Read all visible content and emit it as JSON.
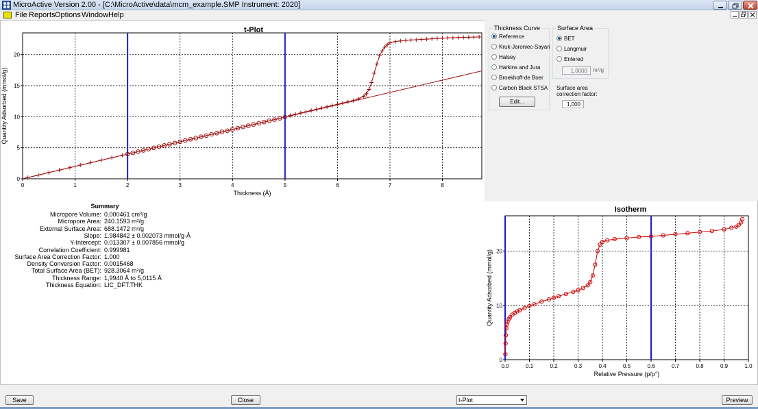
{
  "window": {
    "title": "MicroActive Version 2.00 - [C:\\MicroActive\\data\\mcm_example.SMP Instrument: 2020]"
  },
  "menu": {
    "items": [
      "File",
      "Reports",
      "Options",
      "Window",
      "Help"
    ]
  },
  "options": {
    "thickness_curve": {
      "label": "Thickness Curve",
      "choices": [
        "Reference",
        "Kruk-Jaroniec-Sayari",
        "Halsey",
        "Harkins and Jura",
        "Broekhoff-de Boer",
        "Carbon Black STSA"
      ],
      "selected": "Reference",
      "edit_label": "Edit..."
    },
    "surface_area": {
      "label": "Surface Area",
      "choices": [
        "BET",
        "Langmuir",
        "Entered"
      ],
      "selected": "BET",
      "entered_value": "1,0000",
      "entered_unit": "m²/g"
    },
    "correction": {
      "label": "Surface area correction factor:",
      "value": "1,000"
    }
  },
  "summary": {
    "title": "Summary",
    "rows": [
      {
        "label": "Micropore Volume:",
        "value": "0.000461 cm³/g"
      },
      {
        "label": "Micropore Area:",
        "value": "240.1593 m²/g"
      },
      {
        "label": "External Surface Area:",
        "value": "688.1472 m²/g"
      },
      {
        "label": "Slope:",
        "value": "1.984842 ± 0.002073 mmol/g·Å"
      },
      {
        "label": "Y-Intercept:",
        "value": "0.013307 ± 0.007856 mmol/g"
      },
      {
        "label": "Correlation Coefficient:",
        "value": "0.999981"
      },
      {
        "label": "Surface Area Correction Factor:",
        "value": "1.000"
      },
      {
        "label": "Density Conversion Factor:",
        "value": "0.0015468"
      },
      {
        "label": "Total Surface Area (BET):",
        "value": "928.3064 m²/g"
      },
      {
        "label": "Thickness Range:",
        "value": "1,9940 Å to 5,0115 Å"
      },
      {
        "label": "Thickness Equation:",
        "value": "LIC_DFT.THK"
      }
    ]
  },
  "bottom": {
    "save_label": "Save",
    "close_label": "Close",
    "view_selected": "t-Plot",
    "preview_label": "Preview"
  },
  "chart_data": [
    {
      "type": "scatter",
      "title": "t-Plot",
      "xlabel": "Thickness (Å)",
      "ylabel": "Quantity Adsorbed (mmol/g)",
      "xlim": [
        0,
        8.75
      ],
      "ylim": [
        0,
        23.5
      ],
      "xticks": [
        0,
        1,
        2,
        3,
        4,
        5,
        6,
        7,
        8
      ],
      "yticks": [
        0,
        5,
        10,
        15,
        20
      ],
      "grid": true,
      "colors": {
        "data": "#a01010",
        "fit": "#a01010",
        "range": "#1a1ad0"
      },
      "range_lines_x": [
        2.0,
        5.0
      ],
      "fit_line": {
        "slope": 1.984842,
        "intercept": 0.013307
      },
      "series": [
        {
          "marker": "cross",
          "x": [
            0.1,
            0.3,
            0.5,
            0.7,
            0.9,
            1.1,
            1.3,
            1.5,
            1.7,
            1.9
          ],
          "y": [
            0.2,
            0.6,
            1.0,
            1.4,
            1.8,
            2.2,
            2.6,
            3.0,
            3.4,
            3.8
          ]
        },
        {
          "marker": "circle",
          "x": [
            2.0,
            2.1,
            2.2,
            2.3,
            2.4,
            2.5,
            2.6,
            2.7,
            2.8,
            2.9,
            3.0,
            3.1,
            3.2,
            3.3,
            3.4,
            3.5,
            3.6,
            3.7,
            3.8,
            3.9,
            4.0,
            4.1,
            4.2,
            4.3,
            4.4,
            4.5,
            4.6,
            4.7,
            4.8,
            4.9,
            5.0
          ],
          "y": [
            3.98,
            4.18,
            4.38,
            4.58,
            4.78,
            4.98,
            5.17,
            5.37,
            5.57,
            5.77,
            5.97,
            6.17,
            6.37,
            6.56,
            6.76,
            6.96,
            7.16,
            7.36,
            7.56,
            7.75,
            7.95,
            8.15,
            8.35,
            8.55,
            8.75,
            8.94,
            9.14,
            9.34,
            9.54,
            9.74,
            9.94
          ]
        },
        {
          "marker": "cross",
          "x": [
            5.1,
            5.2,
            5.3,
            5.4,
            5.5,
            5.6,
            5.7,
            5.8,
            5.9,
            6.0,
            6.1,
            6.2,
            6.3,
            6.4,
            6.5,
            6.55,
            6.6,
            6.65,
            6.7,
            6.75,
            6.8,
            6.85,
            6.9,
            6.95,
            7.0,
            7.1,
            7.2,
            7.3,
            7.4,
            7.5,
            7.6,
            7.7,
            7.8,
            7.9,
            8.0,
            8.1,
            8.2,
            8.3,
            8.4,
            8.5,
            8.6,
            8.7
          ],
          "y": [
            10.2,
            10.4,
            10.6,
            10.8,
            11.0,
            11.2,
            11.4,
            11.6,
            11.8,
            12.0,
            12.2,
            12.4,
            12.6,
            12.9,
            13.3,
            13.7,
            14.4,
            15.5,
            17.0,
            18.5,
            19.8,
            20.6,
            21.2,
            21.6,
            21.9,
            22.1,
            22.2,
            22.3,
            22.35,
            22.4,
            22.45,
            22.5,
            22.55,
            22.6,
            22.65,
            22.7,
            22.72,
            22.75,
            22.78,
            22.8,
            22.82,
            22.85
          ]
        }
      ]
    },
    {
      "type": "scatter",
      "title": "Isotherm",
      "xlabel": "Relative Pressure (p/p°)",
      "ylabel": "Quantity Adsorbed (mmol/g)",
      "xlim": [
        0,
        1.0
      ],
      "ylim": [
        0,
        26.5
      ],
      "xticks": [
        0.0,
        0.1,
        0.2,
        0.3,
        0.4,
        0.5,
        0.6,
        0.7,
        0.8,
        0.9,
        1.0
      ],
      "yticks": [
        0,
        10,
        20
      ],
      "grid": true,
      "colors": {
        "data": "#d00000",
        "range": "#1a1ad0"
      },
      "range_lines_x": [
        0.0,
        0.6
      ],
      "series": [
        {
          "marker": "circle",
          "x": [
            0.001,
            0.002,
            0.003,
            0.005,
            0.008,
            0.01,
            0.015,
            0.02,
            0.03,
            0.04,
            0.05,
            0.06,
            0.08,
            0.1,
            0.12,
            0.15,
            0.18,
            0.2,
            0.22,
            0.25,
            0.28,
            0.3,
            0.32,
            0.34,
            0.35,
            0.36,
            0.37,
            0.38,
            0.39,
            0.4,
            0.42,
            0.45,
            0.5,
            0.55,
            0.6,
            0.65,
            0.7,
            0.75,
            0.8,
            0.85,
            0.9,
            0.93,
            0.95,
            0.96,
            0.97,
            0.975
          ],
          "y": [
            1.0,
            3.0,
            4.5,
            5.8,
            6.5,
            7.0,
            7.5,
            7.8,
            8.3,
            8.6,
            8.9,
            9.1,
            9.5,
            9.9,
            10.2,
            10.7,
            11.1,
            11.4,
            11.7,
            12.1,
            12.5,
            12.8,
            13.2,
            13.7,
            14.3,
            15.5,
            17.5,
            20.0,
            21.2,
            21.7,
            22.0,
            22.2,
            22.4,
            22.6,
            22.7,
            22.9,
            23.1,
            23.3,
            23.5,
            23.7,
            24.0,
            24.3,
            24.5,
            24.8,
            25.3,
            25.9
          ]
        }
      ]
    }
  ]
}
